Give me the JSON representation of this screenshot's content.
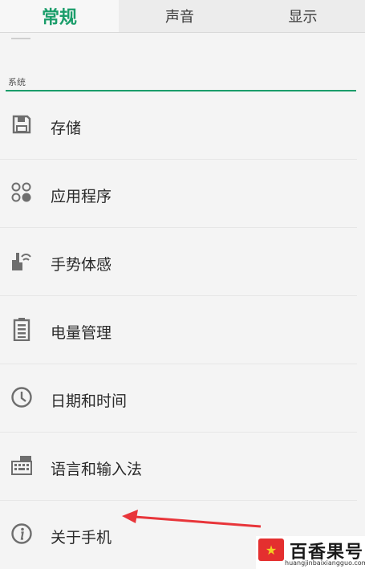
{
  "tabs": [
    {
      "label": "常规",
      "active": true
    },
    {
      "label": "声音",
      "active": false
    },
    {
      "label": "显示",
      "active": false
    }
  ],
  "section": {
    "title": "系统"
  },
  "items": [
    {
      "label": "存储",
      "icon": "storage-icon"
    },
    {
      "label": "应用程序",
      "icon": "apps-icon"
    },
    {
      "label": "手势体感",
      "icon": "gesture-icon"
    },
    {
      "label": "电量管理",
      "icon": "battery-icon"
    },
    {
      "label": "日期和时间",
      "icon": "clock-icon"
    },
    {
      "label": "语言和输入法",
      "icon": "keyboard-icon"
    },
    {
      "label": "关于手机",
      "icon": "info-icon"
    }
  ],
  "watermark": {
    "name": "百香果号",
    "url": "huangjinbaixiangguo.com"
  },
  "colors": {
    "accent": "#1a9d6a",
    "arrow": "#e8353a",
    "logo": "#e42f2f"
  }
}
